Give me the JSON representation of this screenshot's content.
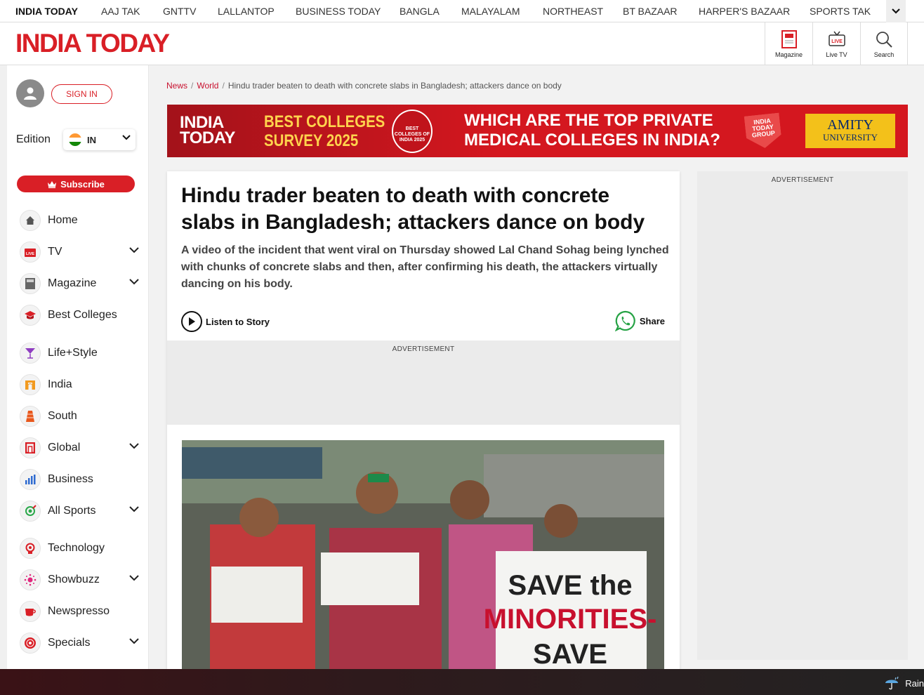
{
  "network_bar": {
    "items": [
      "INDIA TODAY",
      "AAJ TAK",
      "GNTTV",
      "LALLANTOP",
      "BUSINESS TODAY",
      "BANGLA",
      "MALAYALAM",
      "NORTHEAST",
      "BT BAZAAR",
      "HARPER'S BAZAAR",
      "SPORTS TAK"
    ],
    "more_icon": "chevron-down-icon"
  },
  "header": {
    "logo": "INDIA TODAY",
    "buttons": [
      {
        "label": "Magazine",
        "icon": "magazine-icon"
      },
      {
        "label": "Live TV",
        "icon": "live-tv-icon"
      },
      {
        "label": "Search",
        "icon": "search-icon"
      }
    ]
  },
  "sidebar": {
    "sign_in": "SIGN IN",
    "edition_label": "Edition",
    "edition_value": "IN",
    "subscribe": "Subscribe",
    "menu": [
      {
        "label": "Home",
        "icon": "home-icon",
        "expandable": false
      },
      {
        "label": "TV",
        "icon": "live-tv-icon",
        "expandable": true
      },
      {
        "label": "Magazine",
        "icon": "magazine-icon",
        "expandable": true
      },
      {
        "label": "Best Colleges",
        "icon": "graduation-cap-icon",
        "expandable": false
      },
      {
        "label": "Life+Style",
        "icon": "cocktail-icon",
        "expandable": false
      },
      {
        "label": "India",
        "icon": "india-gate-icon",
        "expandable": false
      },
      {
        "label": "South",
        "icon": "temple-icon",
        "expandable": false
      },
      {
        "label": "Global",
        "icon": "globe-icon",
        "expandable": true
      },
      {
        "label": "Business",
        "icon": "bar-chart-icon",
        "expandable": false
      },
      {
        "label": "All Sports",
        "icon": "sports-icon",
        "expandable": true
      },
      {
        "label": "Technology",
        "icon": "technology-icon",
        "expandable": false
      },
      {
        "label": "Showbuzz",
        "icon": "sparkle-icon",
        "expandable": true
      },
      {
        "label": "Newspresso",
        "icon": "coffee-cup-icon",
        "expandable": false
      },
      {
        "label": "Specials",
        "icon": "specials-badge-icon",
        "expandable": true
      }
    ]
  },
  "breadcrumb": {
    "items": [
      "News",
      "World"
    ],
    "current": "Hindu trader beaten to death with concrete slabs in Bangladesh; attackers dance on body"
  },
  "banner": {
    "logo": "INDIA TODAY",
    "survey_line1": "BEST COLLEGES",
    "survey_line2": "SURVEY 2025",
    "badge": "BEST COLLEGES OF INDIA 2025",
    "question_line1": "WHICH ARE THE TOP PRIVATE",
    "question_line2": "MEDICAL COLLEGES IN INDIA?",
    "group": "INDIA TODAY GROUP",
    "sponsor_line1": "AMITY",
    "sponsor_line2": "UNIVERSITY"
  },
  "article": {
    "headline": "Hindu trader beaten to death with concrete slabs in Bangladesh; attackers dance on body",
    "summary": "A video of the incident that went viral on Thursday showed Lal Chand Sohag being lynched with chunks of concrete slabs and then, after confirming his death, the attackers virtually dancing on his body.",
    "listen_label": "Listen to Story",
    "share_label": "Share",
    "ad_label": "ADVERTISEMENT",
    "image_placard_line1": "SAVE the",
    "image_placard_line2": "MINORITIES-",
    "image_placard_line3": "SAVE"
  },
  "right_rail": {
    "ad_label": "ADVERTISEMENT"
  },
  "taskbar": {
    "weather_text": "Rain",
    "weather_icon": "umbrella-rain-icon"
  },
  "colors": {
    "brand_red": "#d91f26",
    "link_red": "#c8102e",
    "whatsapp_green": "#25a244",
    "banner_yellow": "#ffd34d"
  }
}
